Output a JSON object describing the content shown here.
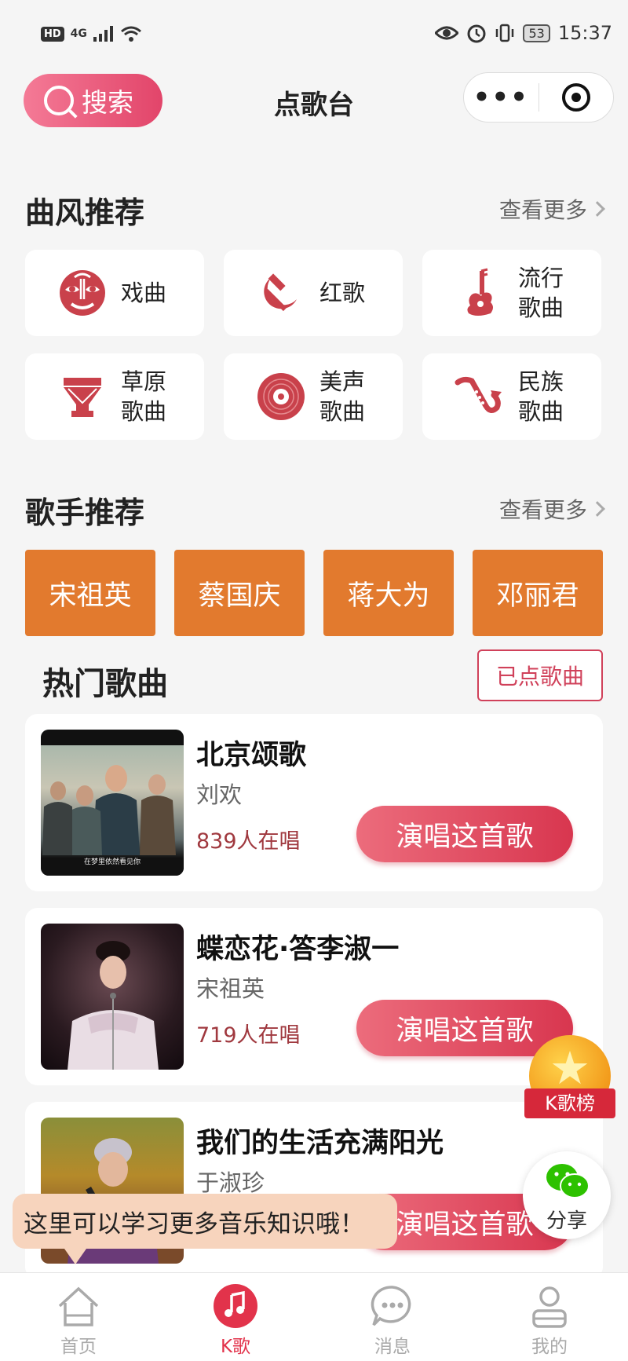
{
  "status_bar": {
    "hd": "HD",
    "network": "4G",
    "battery": "53",
    "time": "15:37"
  },
  "nav": {
    "search_label": "搜索",
    "title": "点歌台",
    "more_label": "•••"
  },
  "genre_section": {
    "title": "曲风推荐",
    "more": "查看更多",
    "items": [
      {
        "label": "戏曲",
        "icon": "opera-mask-icon"
      },
      {
        "label": "红歌",
        "icon": "hammer-sickle-icon"
      },
      {
        "label": "流行歌曲",
        "icon": "guitar-icon"
      },
      {
        "label": "草原歌曲",
        "icon": "drum-icon"
      },
      {
        "label": "美声歌曲",
        "icon": "vinyl-record-icon"
      },
      {
        "label": "民族歌曲",
        "icon": "saxophone-icon"
      }
    ]
  },
  "singer_section": {
    "title": "歌手推荐",
    "more": "查看更多",
    "singers": [
      "宋祖英",
      "蔡国庆",
      "蒋大为",
      "邓丽君"
    ]
  },
  "hot_songs": {
    "title": "热门歌曲",
    "ordered_label": "已点歌曲",
    "sing_label": "演唱这首歌",
    "songs": [
      {
        "name": "北京颂歌",
        "artist": "刘欢",
        "count": "839人在唱",
        "caption": "在梦里依然看见你"
      },
      {
        "name": "蝶恋花·答李淑一",
        "artist": "宋祖英",
        "count": "719人在唱",
        "caption": ""
      },
      {
        "name": "我们的生活充满阳光",
        "artist": "于淑珍",
        "count": "",
        "caption": ""
      }
    ]
  },
  "floating": {
    "kchart_label": "K歌榜",
    "share_label": "分享",
    "tip": "这里可以学习更多音乐知识哦！"
  },
  "tabbar": {
    "tabs": [
      {
        "label": "首页",
        "icon": "home-icon"
      },
      {
        "label": "K歌",
        "icon": "music-note-icon"
      },
      {
        "label": "消息",
        "icon": "message-icon"
      },
      {
        "label": "我的",
        "icon": "profile-icon"
      }
    ]
  },
  "colors": {
    "accent": "#e2456a",
    "singer_bg": "#e27a2e",
    "icon_red": "#c9414b"
  }
}
